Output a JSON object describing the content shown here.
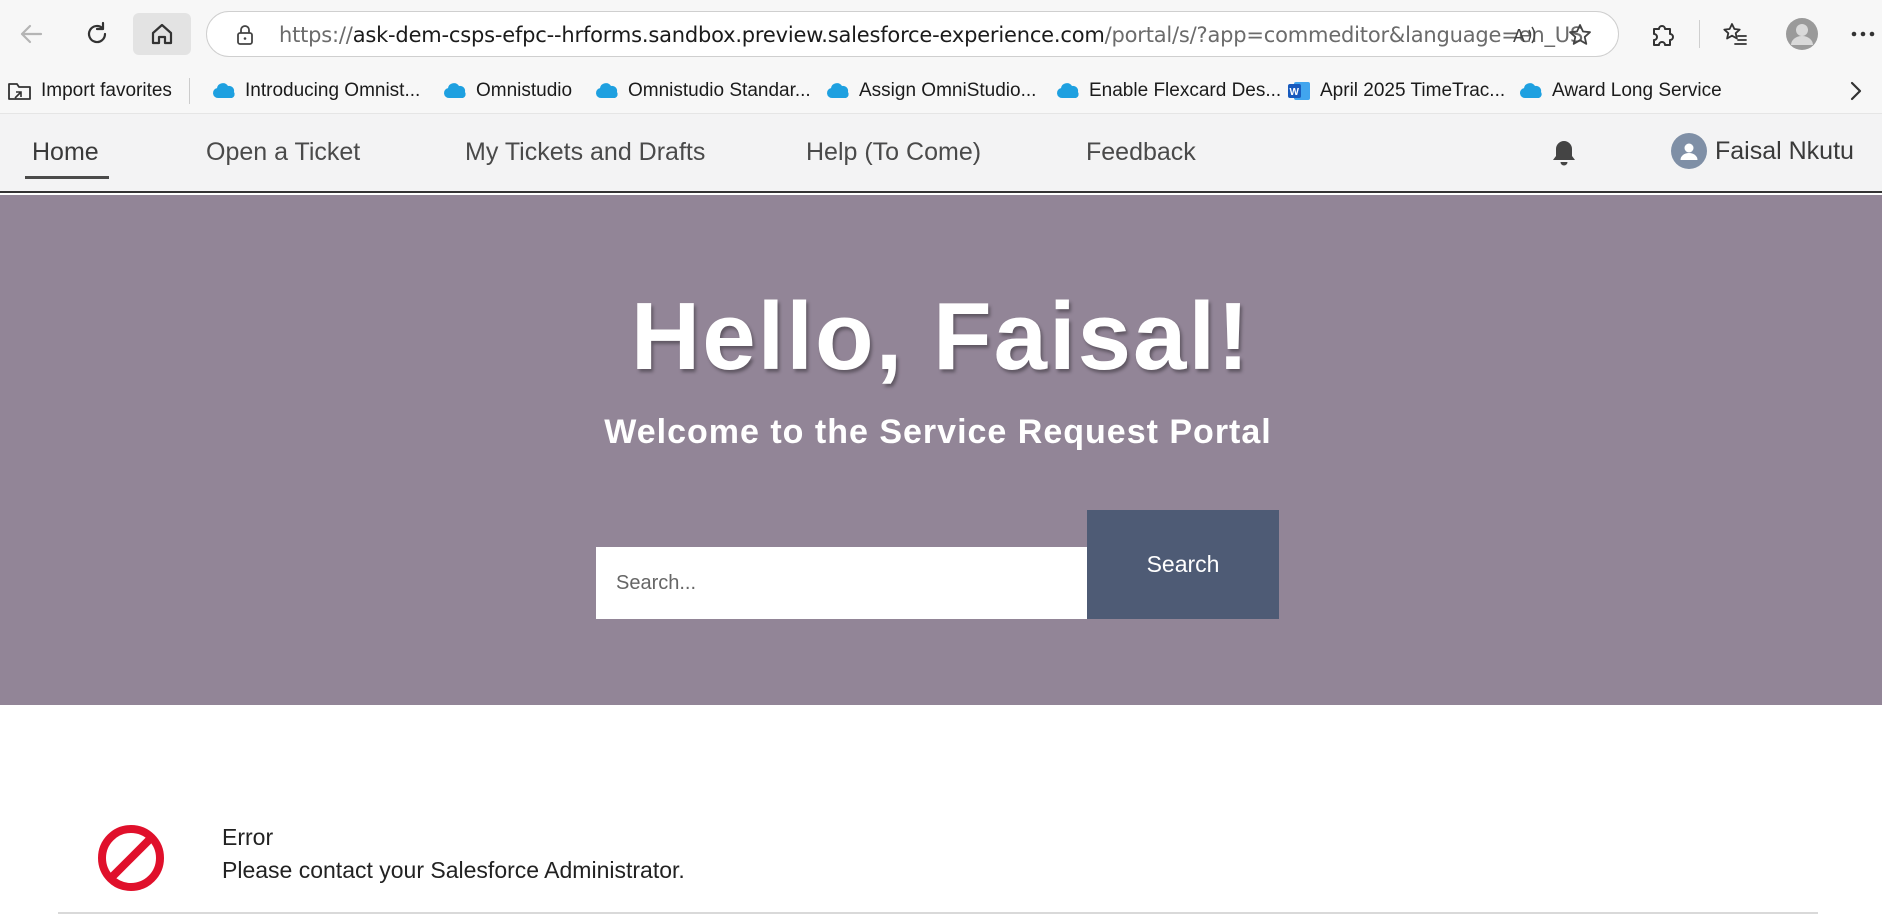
{
  "browser": {
    "url_prefix": "https://",
    "url_host": "ask-dem-csps-efpc--hrforms.sandbox.preview.salesforce-experience.com",
    "url_path": "/portal/s/?app=commeditor&language=en_US"
  },
  "favorites": [
    {
      "label": "Import favorites",
      "icon": "folder-import-icon"
    },
    {
      "label": "Introducing Omnist...",
      "icon": "salesforce-cloud-icon"
    },
    {
      "label": "Omnistudio",
      "icon": "salesforce-cloud-icon"
    },
    {
      "label": "Omnistudio Standar...",
      "icon": "salesforce-cloud-icon"
    },
    {
      "label": "Assign OmniStudio...",
      "icon": "salesforce-cloud-icon"
    },
    {
      "label": "Enable Flexcard Des...",
      "icon": "salesforce-cloud-icon"
    },
    {
      "label": "April 2025 TimeTrac...",
      "icon": "word-icon"
    },
    {
      "label": "Award Long Service",
      "icon": "salesforce-cloud-icon"
    }
  ],
  "nav": {
    "items": [
      "Home",
      "Open a Ticket",
      "My Tickets and Drafts",
      "Help (To Come)",
      "Feedback"
    ],
    "user_name": "Faisal Nkutu"
  },
  "hero": {
    "title": "Hello, Faisal!",
    "subtitle": "Welcome to the Service Request Portal",
    "search_placeholder": "Search...",
    "search_button": "Search"
  },
  "error": {
    "title": "Error",
    "message": "Please contact your Salesforce Administrator."
  },
  "colors": {
    "hero_bg": "#928597",
    "search_btn": "#4e5b75",
    "error_red": "#e0102b",
    "salesforce_blue": "#1ea0e0"
  }
}
